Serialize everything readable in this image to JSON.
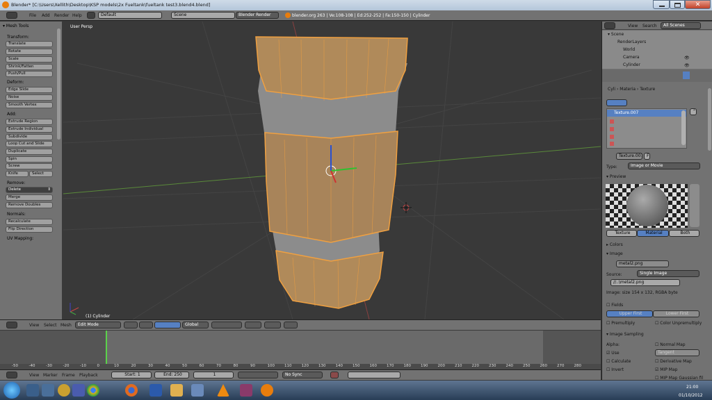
{
  "title": "Blender* [C:\\Users\\Xellith\\Desktop\\KSP models\\2x Fueltank\\fueltank test3.blend4.blend]",
  "menu": {
    "file": "File",
    "add": "Add",
    "render": "Render",
    "help": "Help"
  },
  "header": {
    "layout": "Default",
    "scene": "Scene",
    "engine": "Blender Render",
    "stats": "blender.org 263 | Ve:108-108 | Ed:252-252 | Fa:150-150 | Cylinder"
  },
  "toolshelf": {
    "title": "Mesh Tools",
    "transform_head": "Transform:",
    "translate": "Translate",
    "rotate": "Rotate",
    "scale": "Scale",
    "shrink": "Shrink/Fatten",
    "push": "Push/Pull",
    "deform_head": "Deform:",
    "edge_slide": "Edge Slide",
    "noise": "Noise",
    "smooth": "Smooth Vertex",
    "add_head": "Add:",
    "extrude_region": "Extrude Region",
    "extrude_individual": "Extrude Individual",
    "subdivide": "Subdivide",
    "loop_cut": "Loop Cut and Slide",
    "duplicate": "Duplicate",
    "spin": "Spin",
    "screw": "Screw",
    "knife": "Knife",
    "select": "Select",
    "remove_head": "Remove:",
    "delete": "Delete",
    "merge": "Merge",
    "remove_doubles": "Remove Doubles",
    "normals_head": "Normals:",
    "recalculate": "Recalculate",
    "flip": "Flip Direction",
    "uv_head": "UV Mapping:"
  },
  "viewport": {
    "view_name": "User Persp",
    "object_label": "(1) Cylinder"
  },
  "vp_header": {
    "view": "View",
    "select": "Select",
    "mesh": "Mesh",
    "mode": "Edit Mode",
    "orientation": "Global"
  },
  "timeline": {
    "ticks": [
      "-50",
      "-40",
      "-30",
      "-20",
      "-10",
      "0",
      "10",
      "20",
      "30",
      "40",
      "50",
      "60",
      "70",
      "80",
      "90",
      "100",
      "110",
      "120",
      "130",
      "140",
      "150",
      "160",
      "170",
      "180",
      "190",
      "200",
      "210",
      "220",
      "230",
      "240",
      "250",
      "260",
      "270",
      "280"
    ],
    "current_frame": 1
  },
  "tl_header": {
    "view": "View",
    "marker": "Marker",
    "frame": "Frame",
    "playback": "Playback",
    "start": "Start: 1",
    "end": "End: 250",
    "current": "1",
    "sync": "No Sync"
  },
  "outliner": {
    "view": "View",
    "search": "Search",
    "filter": "All Scenes",
    "scene": "Scene",
    "render_layers": "RenderLayers",
    "world": "World",
    "camera": "Camera",
    "cylinder": "Cylinder"
  },
  "props": {
    "crumb1": "Cyli",
    "crumb2": "Materia",
    "crumb3": "Texture",
    "slot_selected": "Texture.007",
    "tex_name": "Texture.007",
    "tex_f": "F",
    "type_label": "Type:",
    "type_value": "Image or Movie",
    "preview_head": "Preview",
    "tab_texture": "Texture",
    "tab_material": "Material",
    "tab_both": "Both",
    "colors_head": "Colors",
    "image_head": "Image",
    "image_name": "metal2.png",
    "source_label": "Source:",
    "source_value": "Single Image",
    "path": "//..\\metal2.png",
    "image_info": "Image: size 154 x 132, RGBA byte",
    "fields": "Fields",
    "upper_first": "Upper First",
    "lower_first": "Lower First",
    "premultiply": "Premultiply",
    "color_unpremultiply": "Color Unpremultiply",
    "sampling_head": "Image Sampling",
    "alpha_label": "Alpha:",
    "normal_map": "Normal Map",
    "use": "Use",
    "tangent": "Tangent",
    "calculate": "Calculate",
    "derivative_map": "Derivative Map",
    "invert": "Invert",
    "mip_map": "MIP Map",
    "mip_gauss": "MIP Map Gaussian fil"
  },
  "taskbar": {
    "time": "21:00",
    "date": "01/10/2012"
  },
  "colors": {
    "accent": "#5680c2",
    "object_orange": "#f0a040",
    "bg_panel": "#727272",
    "viewport": "#393939"
  }
}
